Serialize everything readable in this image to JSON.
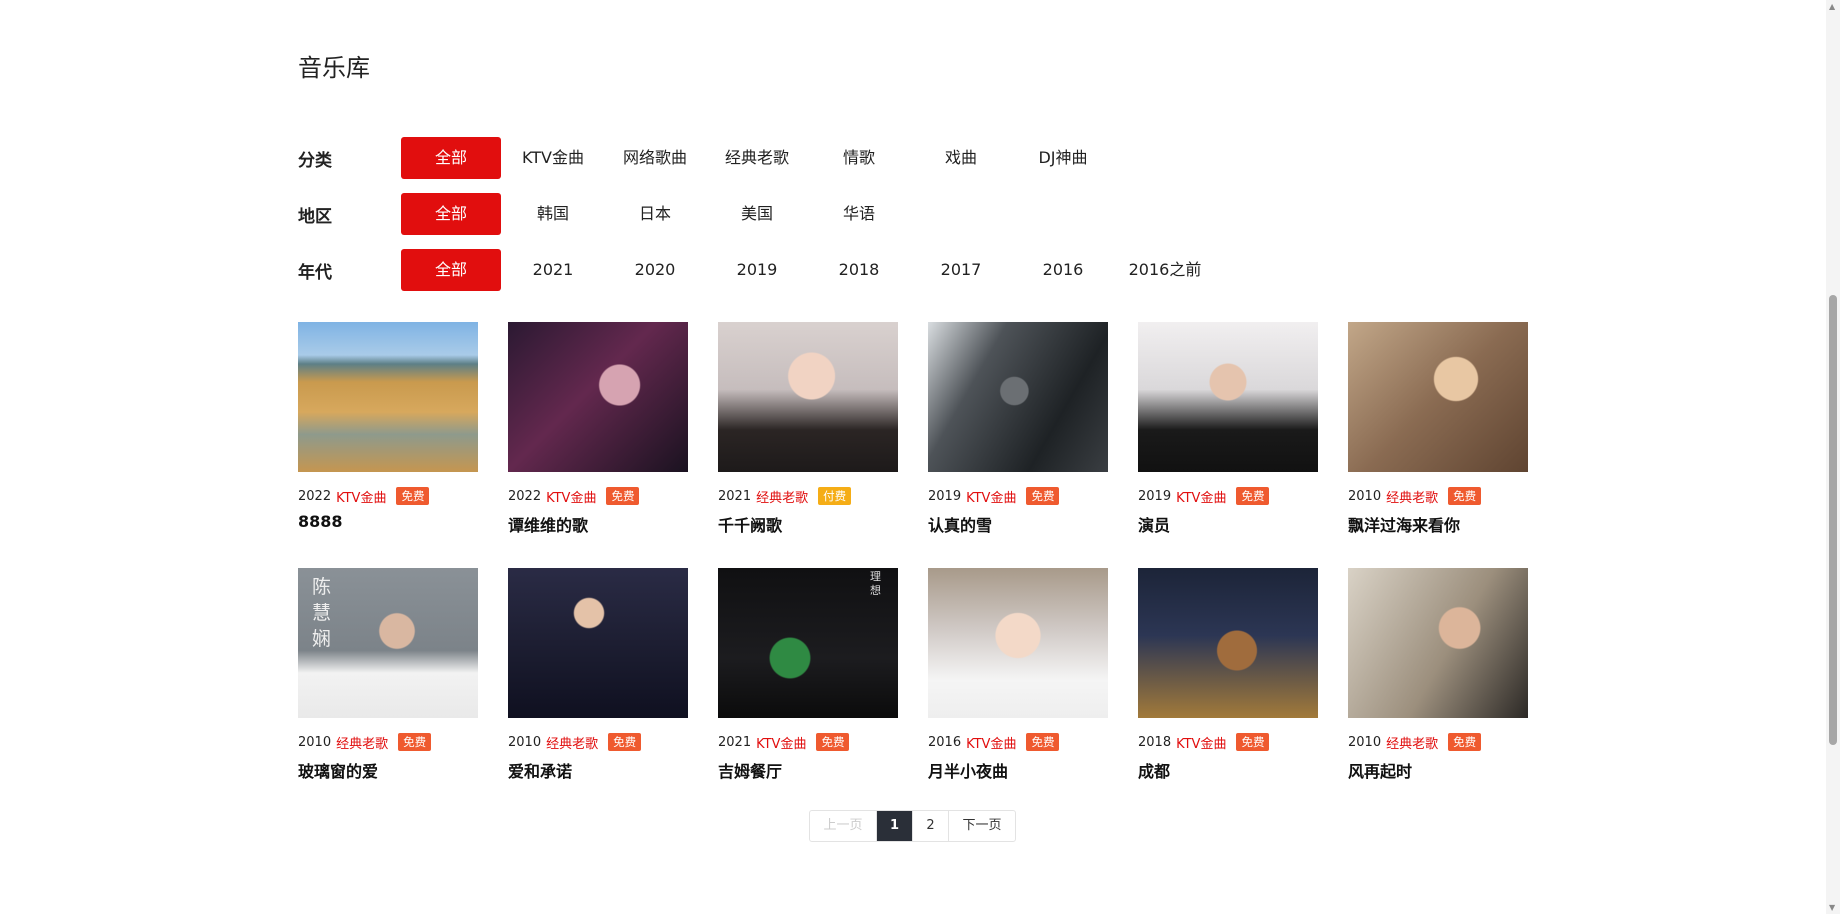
{
  "page": {
    "title": "音乐库"
  },
  "filters": {
    "category": {
      "label": "分类",
      "options": [
        "全部",
        "KTV金曲",
        "网络歌曲",
        "经典老歌",
        "情歌",
        "戏曲",
        "DJ神曲"
      ],
      "active": 0
    },
    "region": {
      "label": "地区",
      "options": [
        "全部",
        "韩国",
        "日本",
        "美国",
        "华语"
      ],
      "active": 0
    },
    "era": {
      "label": "年代",
      "options": [
        "全部",
        "2021",
        "2020",
        "2019",
        "2018",
        "2017",
        "2016",
        "2016之前"
      ],
      "active": 0
    }
  },
  "songs": [
    {
      "year": "2022",
      "category": "KTV金曲",
      "badge": "免费",
      "title": "8888"
    },
    {
      "year": "2022",
      "category": "KTV金曲",
      "badge": "免费",
      "title": "谭维维的歌"
    },
    {
      "year": "2021",
      "category": "经典老歌",
      "badge": "付费",
      "title": "千千阙歌"
    },
    {
      "year": "2019",
      "category": "KTV金曲",
      "badge": "免费",
      "title": "认真的雪"
    },
    {
      "year": "2019",
      "category": "KTV金曲",
      "badge": "免费",
      "title": "演员"
    },
    {
      "year": "2010",
      "category": "经典老歌",
      "badge": "免费",
      "title": "飘洋过海来看你"
    },
    {
      "year": "2010",
      "category": "经典老歌",
      "badge": "免费",
      "title": "玻璃窗的爱",
      "cover_text": "陈慧娴"
    },
    {
      "year": "2010",
      "category": "经典老歌",
      "badge": "免费",
      "title": "爱和承诺"
    },
    {
      "year": "2021",
      "category": "KTV金曲",
      "badge": "免费",
      "title": "吉姆餐厅",
      "cover_text": "理想"
    },
    {
      "year": "2016",
      "category": "KTV金曲",
      "badge": "免费",
      "title": "月半小夜曲"
    },
    {
      "year": "2018",
      "category": "KTV金曲",
      "badge": "免费",
      "title": "成都"
    },
    {
      "year": "2010",
      "category": "经典老歌",
      "badge": "免费",
      "title": "风再起时"
    }
  ],
  "pagination": {
    "prev": "上一页",
    "pages": [
      "1",
      "2"
    ],
    "current": "1",
    "next": "下一页"
  },
  "colors": {
    "accent": "#e10e0e",
    "free_badge": "#ef5a2f",
    "paid_badge": "#f5ad16",
    "current_page": "#2a2f38"
  }
}
